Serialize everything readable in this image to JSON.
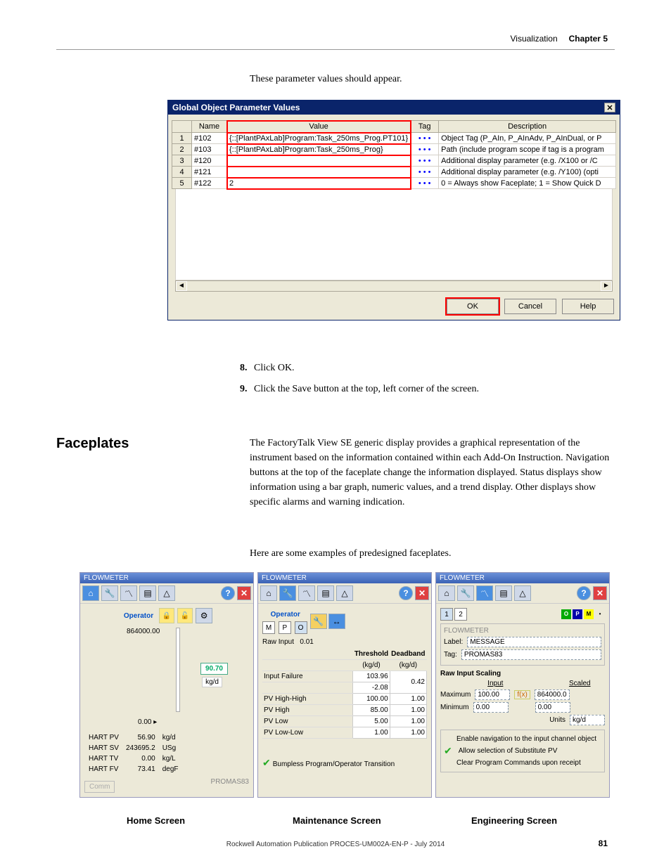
{
  "header": {
    "left": "Visualization",
    "right": "Chapter 5"
  },
  "intro": "These parameter values should appear.",
  "dialog": {
    "title": "Global Object Parameter Values",
    "cols": {
      "name": "Name",
      "value": "Value",
      "tag": "Tag",
      "desc": "Description"
    },
    "rows": [
      {
        "n": "1",
        "name": "#102",
        "value": "{::[PlantPAxLab]Program:Task_250ms_Prog.PT101}",
        "desc": "Object Tag (P_AIn, P_AInAdv, P_AInDual, or P"
      },
      {
        "n": "2",
        "name": "#103",
        "value": "{::[PlantPAxLab]Program:Task_250ms_Prog}",
        "desc": "Path (include program scope if tag is a program"
      },
      {
        "n": "3",
        "name": "#120",
        "value": "",
        "desc": "Additional display parameter (e.g. /X100 or /C"
      },
      {
        "n": "4",
        "name": "#121",
        "value": "",
        "desc": "Additional display parameter (e.g. /Y100) (opti"
      },
      {
        "n": "5",
        "name": "#122",
        "value": "2",
        "desc": "0 = Always show Faceplate;  1 = Show Quick D"
      }
    ],
    "ellipsis": "• • •",
    "btns": {
      "ok": "OK",
      "cancel": "Cancel",
      "help": "Help"
    }
  },
  "steps": {
    "s8": "Click OK.",
    "s9": "Click the Save button at the top, left corner of the screen."
  },
  "section": {
    "title": "Faceplates",
    "body": "The FactoryTalk View SE generic display provides a graphical representation of the instrument based on the information contained within each Add-On Instruction. Navigation buttons at the top of the faceplate change the information displayed. Status displays show information using a bar graph, numeric values, and a trend display. Other displays show specific alarms and warning indication.",
    "lead": "Here are some examples of predesigned faceplates."
  },
  "fp": {
    "title": "FLOWMETER",
    "operator": "Operator",
    "home": {
      "max": "864000.00",
      "min": "0.00",
      "val": "90.70",
      "unit": "kg/d",
      "hart": [
        [
          "HART PV",
          "56.90",
          "kg/d"
        ],
        [
          "HART SV",
          "243695.2",
          "USg"
        ],
        [
          "HART TV",
          "0.00",
          "kg/L"
        ],
        [
          "HART FV",
          "73.41",
          "degF"
        ]
      ],
      "comm": "Comm",
      "tag": "PROMAS83"
    },
    "maint": {
      "m": "M",
      "p": "P",
      "o": "O",
      "raw": "Raw Input",
      "rawv": "0.01",
      "thH": "Threshold",
      "dbH": "Deadband",
      "u": "(kg/d)",
      "rows": [
        [
          "Input Failure",
          "103.96",
          "0.42"
        ],
        [
          "",
          "-2.08",
          ""
        ],
        [
          "PV High-High",
          "100.00",
          "1.00"
        ],
        [
          "PV High",
          "85.00",
          "1.00"
        ],
        [
          "PV Low",
          "5.00",
          "1.00"
        ],
        [
          "PV Low-Low",
          "1.00",
          "1.00"
        ]
      ],
      "bump": "Bumpless Program/Operator Transition"
    },
    "eng": {
      "t1": "1",
      "t2": "2",
      "grp": "FLOWMETER",
      "lblL": "Label:",
      "lblV": "MESSAGE",
      "tagL": "Tag:",
      "tagV": "PROMAS83",
      "ris": "Raw Input Scaling",
      "inp": "Input",
      "sca": "Scaled",
      "maxL": "Maximum",
      "maxI": "100.00",
      "maxS": "864000.0",
      "fx": "f(x)",
      "minL": "Minimum",
      "minI": "0.00",
      "minS": "0.00",
      "unitsL": "Units",
      "unitsV": "kg/d",
      "c1": "Enable navigation to the input channel object",
      "c2": "Allow selection of Substitute PV",
      "c3": "Clear Program Commands upon receipt"
    },
    "caps": {
      "h": "Home Screen",
      "m": "Maintenance Screen",
      "e": "Engineering Screen"
    }
  },
  "footer": {
    "pub": "Rockwell Automation Publication PROCES-UM002A-EN-P - July 2014",
    "page": "81"
  }
}
